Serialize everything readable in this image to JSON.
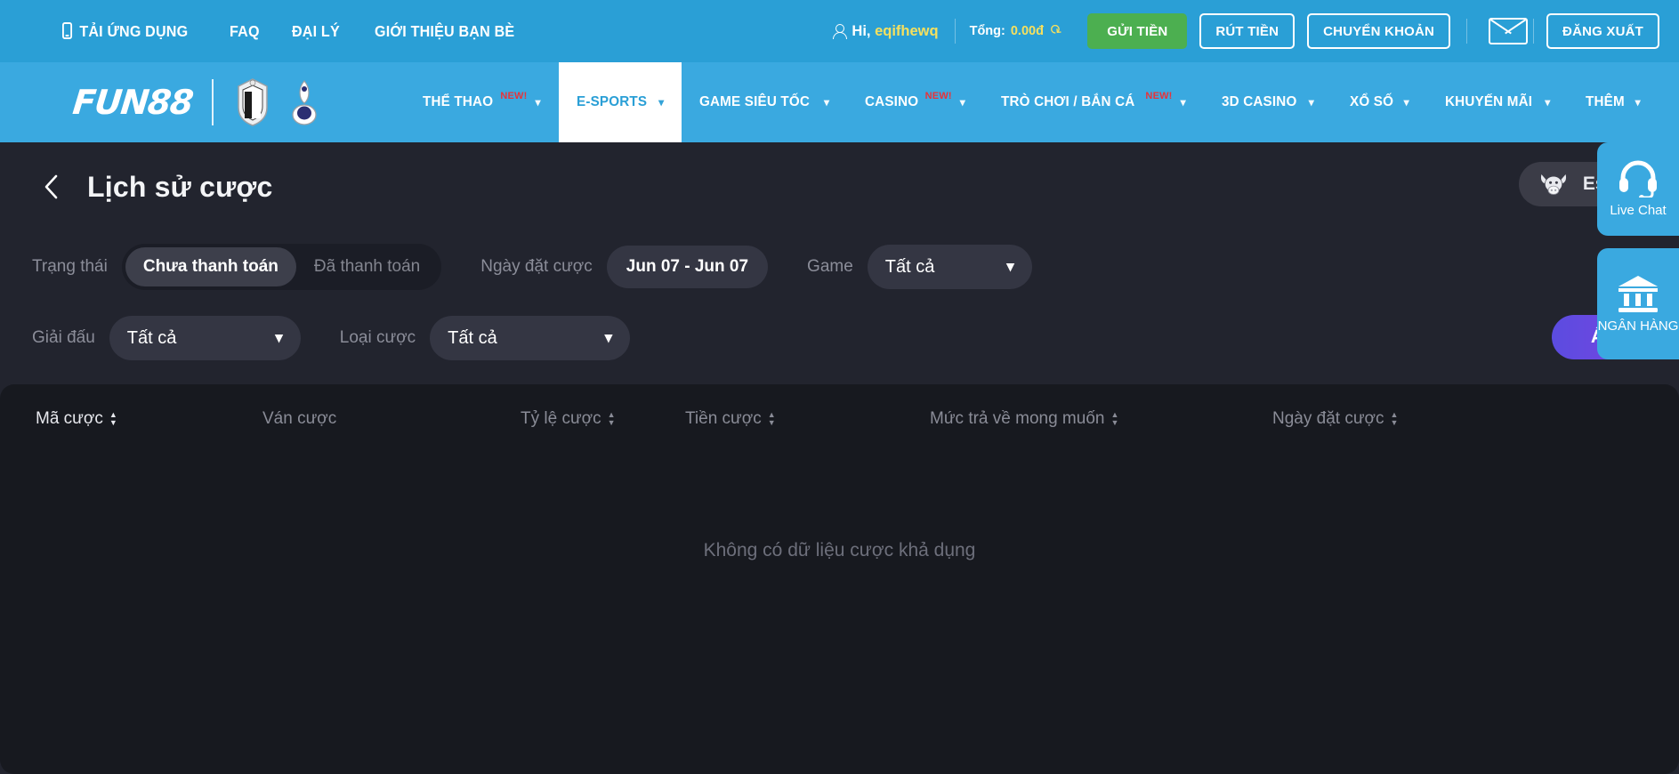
{
  "topbar": {
    "links": [
      {
        "label": "TẢI ỨNG DỤNG",
        "icon": "mobile-icon"
      },
      {
        "label": "FAQ",
        "icon": ""
      },
      {
        "label": "ĐẠI LÝ",
        "icon": ""
      },
      {
        "label": "GIỚI THIỆU BẠN BÈ",
        "icon": ""
      }
    ],
    "greeting_prefix": "Hi, ",
    "username": "eqifhewq",
    "balance_label": "Tổng: ",
    "balance_value": "0.00đ",
    "refresh_icon": "refresh-icon",
    "deposit_label": "GỬI TIỀN",
    "withdraw_label": "RÚT TIỀN",
    "transfer_label": "CHUYỂN KHOẢN",
    "mail_icon": "mail-icon",
    "logout_label": "ĐĂNG XUẤT"
  },
  "nav": {
    "logo": "FUN88",
    "items": [
      {
        "label": "THỂ THAO",
        "tag": "NEW!",
        "caret": "⌄",
        "active": false
      },
      {
        "label": "E-SPORTS",
        "tag": "",
        "caret": "⌄",
        "active": true
      },
      {
        "label": "GAME SIÊU TỐC",
        "tag": "",
        "caret": "⌄",
        "active": false
      },
      {
        "label": "CASINO",
        "tag": "NEW!",
        "caret": "⌄",
        "active": false
      },
      {
        "label": "TRÒ CHƠI / BẮN CÁ",
        "tag": "NEW!",
        "caret": "⌄",
        "active": false
      },
      {
        "label": "3D CASINO",
        "tag": "",
        "caret": "⌄",
        "active": false
      },
      {
        "label": "XỔ SỐ",
        "tag": "",
        "caret": "⌄",
        "active": false
      },
      {
        "label": "KHUYẾN MÃI",
        "tag": "",
        "caret": "⌄",
        "active": false
      },
      {
        "label": "THÊM",
        "tag": "",
        "caret": "⌄",
        "active": false
      }
    ]
  },
  "page": {
    "back_icon": "chevron-left-icon",
    "title": "Lịch sử cược",
    "esports_badge": {
      "icon": "bull-icon",
      "label": "Esports"
    }
  },
  "filters": {
    "status_label": "Trạng thái",
    "status_options": [
      {
        "label": "Chưa thanh toán",
        "selected": true
      },
      {
        "label": "Đã thanh toán",
        "selected": false
      }
    ],
    "date_label": "Ngày đặt cược",
    "date_value": "Jun 07 - Jun 07",
    "game_label": "Game",
    "game_value": "Tất cả",
    "league_label": "Giải đấu",
    "league_value": "Tất cả",
    "bettype_label": "Loại cược",
    "bettype_value": "Tất cả",
    "apply_label": "Áp dụng",
    "chevron": "⌄"
  },
  "table": {
    "columns": [
      {
        "label": "Mã cược",
        "sortable": true
      },
      {
        "label": "Ván cược",
        "sortable": false
      },
      {
        "label": "Tỷ lệ cược",
        "sortable": true
      },
      {
        "label": "Tiền cược",
        "sortable": true
      },
      {
        "label": "Mức trả về mong muốn",
        "sortable": true
      },
      {
        "label": "Ngày đặt cược",
        "sortable": true
      }
    ],
    "rows": [],
    "empty_message": "Không có dữ liệu cược khả dụng"
  },
  "side_widgets": [
    {
      "icon": "headset-icon",
      "label": "Live Chat"
    },
    {
      "icon": "bank-icon",
      "label": "NGÂN HÀNG"
    }
  ],
  "colors": {
    "brand_blue": "#3aa9e0",
    "topbar_blue": "#2a9fd6",
    "deposit_green": "#4caf50",
    "accent_yellow": "#f6e05e",
    "new_red": "#e8333a",
    "apply_purple": "#7a43e0",
    "page_bg": "#22242e",
    "card_bg": "#17191f"
  }
}
